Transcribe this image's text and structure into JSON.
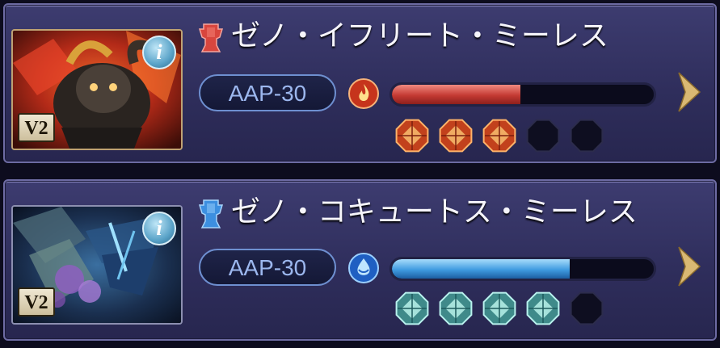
{
  "summons": [
    {
      "name": "ゼノ・イフリート・ミーレス",
      "badge": "V2",
      "info_icon": "i",
      "aap": "AAP-30",
      "element": "fire",
      "element_icon": "fire-element-icon",
      "progress": 0.49,
      "gems_filled": 3,
      "gems_total": 5,
      "accent": "#d9534a",
      "trophy_color": "#d9463e"
    },
    {
      "name": "ゼノ・コキュートス・ミーレス",
      "badge": "V2",
      "info_icon": "i",
      "aap": "AAP-30",
      "element": "water",
      "element_icon": "water-element-icon",
      "progress": 0.68,
      "gems_filled": 4,
      "gems_total": 5,
      "accent": "#4aa6e3",
      "trophy_color": "#3d8fe0"
    }
  ]
}
